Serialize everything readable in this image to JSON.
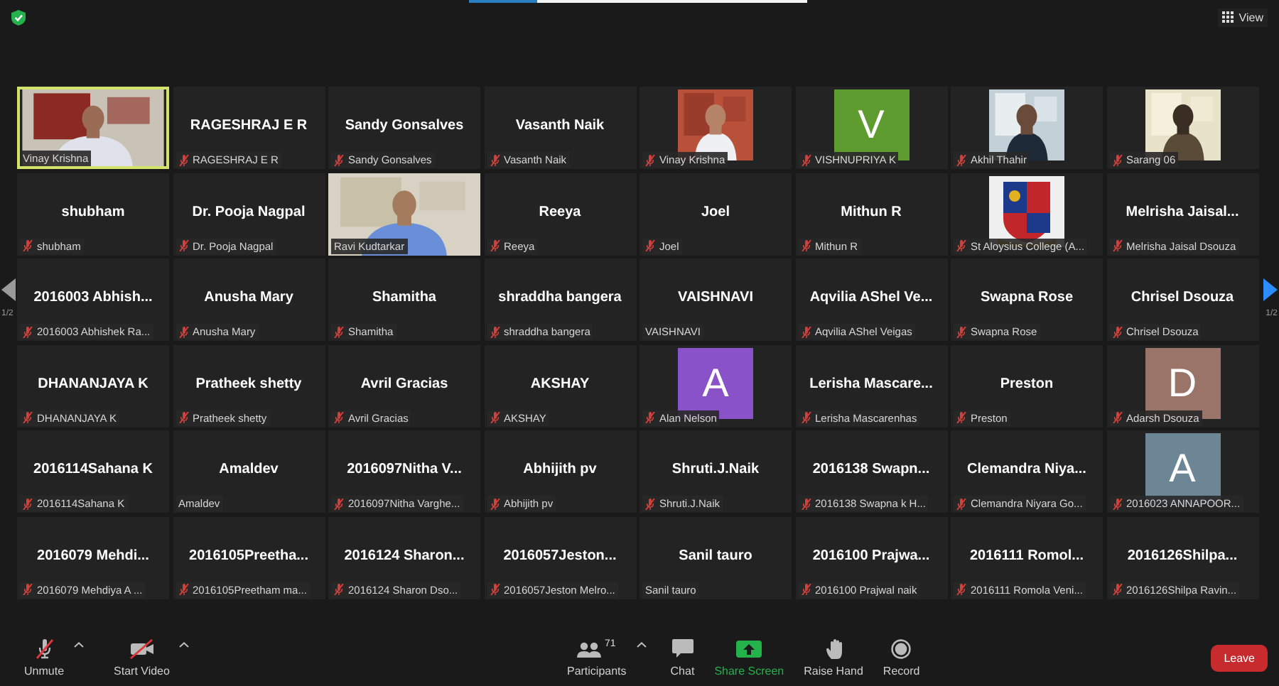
{
  "top_bar": {
    "view_button": "View"
  },
  "pager": {
    "left": "1/2",
    "right": "1/2"
  },
  "tiles": [
    {
      "kind": "camera",
      "label": "Vinay Krishna",
      "muted": false,
      "active": true
    },
    {
      "kind": "name",
      "title": "RAGESHRAJ E R",
      "label": "RAGESHRAJ E R",
      "muted": true,
      "active": false
    },
    {
      "kind": "name",
      "title": "Sandy Gonsalves",
      "label": "Sandy Gonsalves",
      "muted": true,
      "active": false
    },
    {
      "kind": "name",
      "title": "Vasanth Naik",
      "label": "Vasanth Naik",
      "muted": true,
      "active": false
    },
    {
      "label": "Vinay Krishna",
      "muted": true,
      "active": false
    },
    {
      "kind": "avatar",
      "letter": "V",
      "color": "#5e9c2f",
      "label": "VISHNUPRIYA K",
      "muted": true,
      "active": false
    },
    {
      "label": "Akhil Thahir",
      "muted": true,
      "active": false
    },
    {
      "label": "Sarang 06",
      "muted": true,
      "active": false
    },
    {
      "kind": "name",
      "title": "shubham",
      "label": "shubham",
      "muted": true,
      "active": false
    },
    {
      "kind": "name",
      "title": "Dr. Pooja Nagpal",
      "label": "Dr. Pooja Nagpal",
      "muted": true,
      "active": false
    },
    {
      "kind": "camera",
      "label": "Ravi Kudtarkar",
      "muted": false,
      "active": false
    },
    {
      "kind": "name",
      "title": "Reeya",
      "label": "Reeya",
      "muted": true,
      "active": false
    },
    {
      "kind": "name",
      "title": "Joel",
      "label": "Joel",
      "muted": true,
      "active": false
    },
    {
      "kind": "name",
      "title": "Mithun R",
      "label": "Mithun R",
      "muted": true,
      "active": false
    },
    {
      "label": "St Aloysius College (A...",
      "muted": true,
      "active": false
    },
    {
      "kind": "name",
      "title": "Melrisha Jaisal...",
      "label": "Melrisha Jaisal Dsouza",
      "muted": true,
      "active": false
    },
    {
      "kind": "name",
      "title": "2016003 Abhish...",
      "label": "2016003 Abhishek Ra...",
      "muted": true,
      "active": false
    },
    {
      "kind": "name",
      "title": "Anusha Mary",
      "label": "Anusha Mary",
      "muted": true,
      "active": false
    },
    {
      "kind": "name",
      "title": "Shamitha",
      "label": "Shamitha",
      "muted": true,
      "active": false
    },
    {
      "kind": "name",
      "title": "shraddha bangera",
      "label": "shraddha bangera",
      "muted": true,
      "active": false
    },
    {
      "kind": "name",
      "title": "VAISHNAVI",
      "label": "VAISHNAVI",
      "muted": false,
      "active": false
    },
    {
      "kind": "name",
      "title": "Aqvilia AShel Ve...",
      "label": "Aqvilia AShel Veigas",
      "muted": true,
      "active": false
    },
    {
      "kind": "name",
      "title": "Swapna Rose",
      "label": "Swapna Rose",
      "muted": true,
      "active": false
    },
    {
      "kind": "name",
      "title": "Chrisel Dsouza",
      "label": "Chrisel Dsouza",
      "muted": true,
      "active": false
    },
    {
      "kind": "name",
      "title": "DHANANJAYA K",
      "label": "DHANANJAYA K",
      "muted": true,
      "active": false
    },
    {
      "kind": "name",
      "title": "Pratheek shetty",
      "label": "Pratheek shetty",
      "muted": true,
      "active": false
    },
    {
      "kind": "name",
      "title": "Avril Gracias",
      "label": "Avril Gracias",
      "muted": true,
      "active": false
    },
    {
      "kind": "name",
      "title": "AKSHAY",
      "label": "AKSHAY",
      "muted": true,
      "active": false
    },
    {
      "kind": "avatar",
      "letter": "A",
      "color": "#8a52c8",
      "label": "Alan Nelson",
      "muted": true,
      "active": false
    },
    {
      "kind": "name",
      "title": "Lerisha Mascare...",
      "label": "Lerisha Mascarenhas",
      "muted": true,
      "active": false
    },
    {
      "kind": "name",
      "title": "Preston",
      "label": "Preston",
      "muted": true,
      "active": false
    },
    {
      "kind": "avatar",
      "letter": "D",
      "color": "#9a7468",
      "label": "Adarsh Dsouza",
      "muted": true,
      "active": false
    },
    {
      "kind": "name",
      "title": "2016114Sahana K",
      "label": "2016114Sahana K",
      "muted": true,
      "active": false
    },
    {
      "kind": "name",
      "title": "Amaldev",
      "label": "Amaldev",
      "muted": false,
      "active": false
    },
    {
      "kind": "name",
      "title": "2016097Nitha V...",
      "label": "2016097Nitha Varghe...",
      "muted": true,
      "active": false
    },
    {
      "kind": "name",
      "title": "Abhijith pv",
      "label": "Abhijith pv",
      "muted": true,
      "active": false
    },
    {
      "kind": "name",
      "title": "Shruti.J.Naik",
      "label": "Shruti.J.Naik",
      "muted": true,
      "active": false
    },
    {
      "kind": "name",
      "title": "2016138 Swapn...",
      "label": "2016138 Swapna k H...",
      "muted": true,
      "active": false
    },
    {
      "kind": "name",
      "title": "Clemandra Niya...",
      "label": "Clemandra Niyara Go...",
      "muted": true,
      "active": false
    },
    {
      "kind": "avatar",
      "letter": "A",
      "color": "#6d8696",
      "label": "2016023 ANNAPOOR...",
      "muted": true,
      "active": false
    },
    {
      "kind": "name",
      "title": "2016079 Mehdi...",
      "label": "2016079 Mehdiya A ...",
      "muted": true,
      "active": false
    },
    {
      "kind": "name",
      "title": "2016105Preetha...",
      "label": "2016105Preetham ma...",
      "muted": true,
      "active": false
    },
    {
      "kind": "name",
      "title": "2016124 Sharon...",
      "label": "2016124 Sharon Dso...",
      "muted": true,
      "active": false
    },
    {
      "kind": "name",
      "title": "2016057Jeston...",
      "label": "2016057Jeston Melro...",
      "muted": true,
      "active": false
    },
    {
      "kind": "name",
      "title": "Sanil tauro",
      "label": "Sanil tauro",
      "muted": false,
      "active": false
    },
    {
      "kind": "name",
      "title": "2016100 Prajwa...",
      "label": "2016100 Prajwal naik",
      "muted": true,
      "active": false
    },
    {
      "kind": "name",
      "title": "2016111 Romol...",
      "label": "2016111 Romola Veni...",
      "muted": true,
      "active": false
    },
    {
      "kind": "name",
      "title": "2016126Shilpa...",
      "label": "2016126Shilpa Ravin...",
      "muted": true,
      "active": false
    }
  ],
  "toolbar": {
    "items": [
      {
        "kind": "mic",
        "label": "Unmute",
        "menu": true
      },
      {
        "kind": "video",
        "label": "Start Video",
        "menu": true
      },
      {
        "kind": "participants",
        "label": "Participants",
        "count": "71",
        "menu": true
      },
      {
        "kind": "chat",
        "label": "Chat",
        "menu": false
      },
      {
        "kind": "share",
        "label": "Share Screen",
        "menu": false
      },
      {
        "kind": "hand",
        "label": "Raise Hand",
        "menu": false
      },
      {
        "kind": "record",
        "label": "Record",
        "menu": false
      }
    ],
    "leave": "Leave"
  }
}
